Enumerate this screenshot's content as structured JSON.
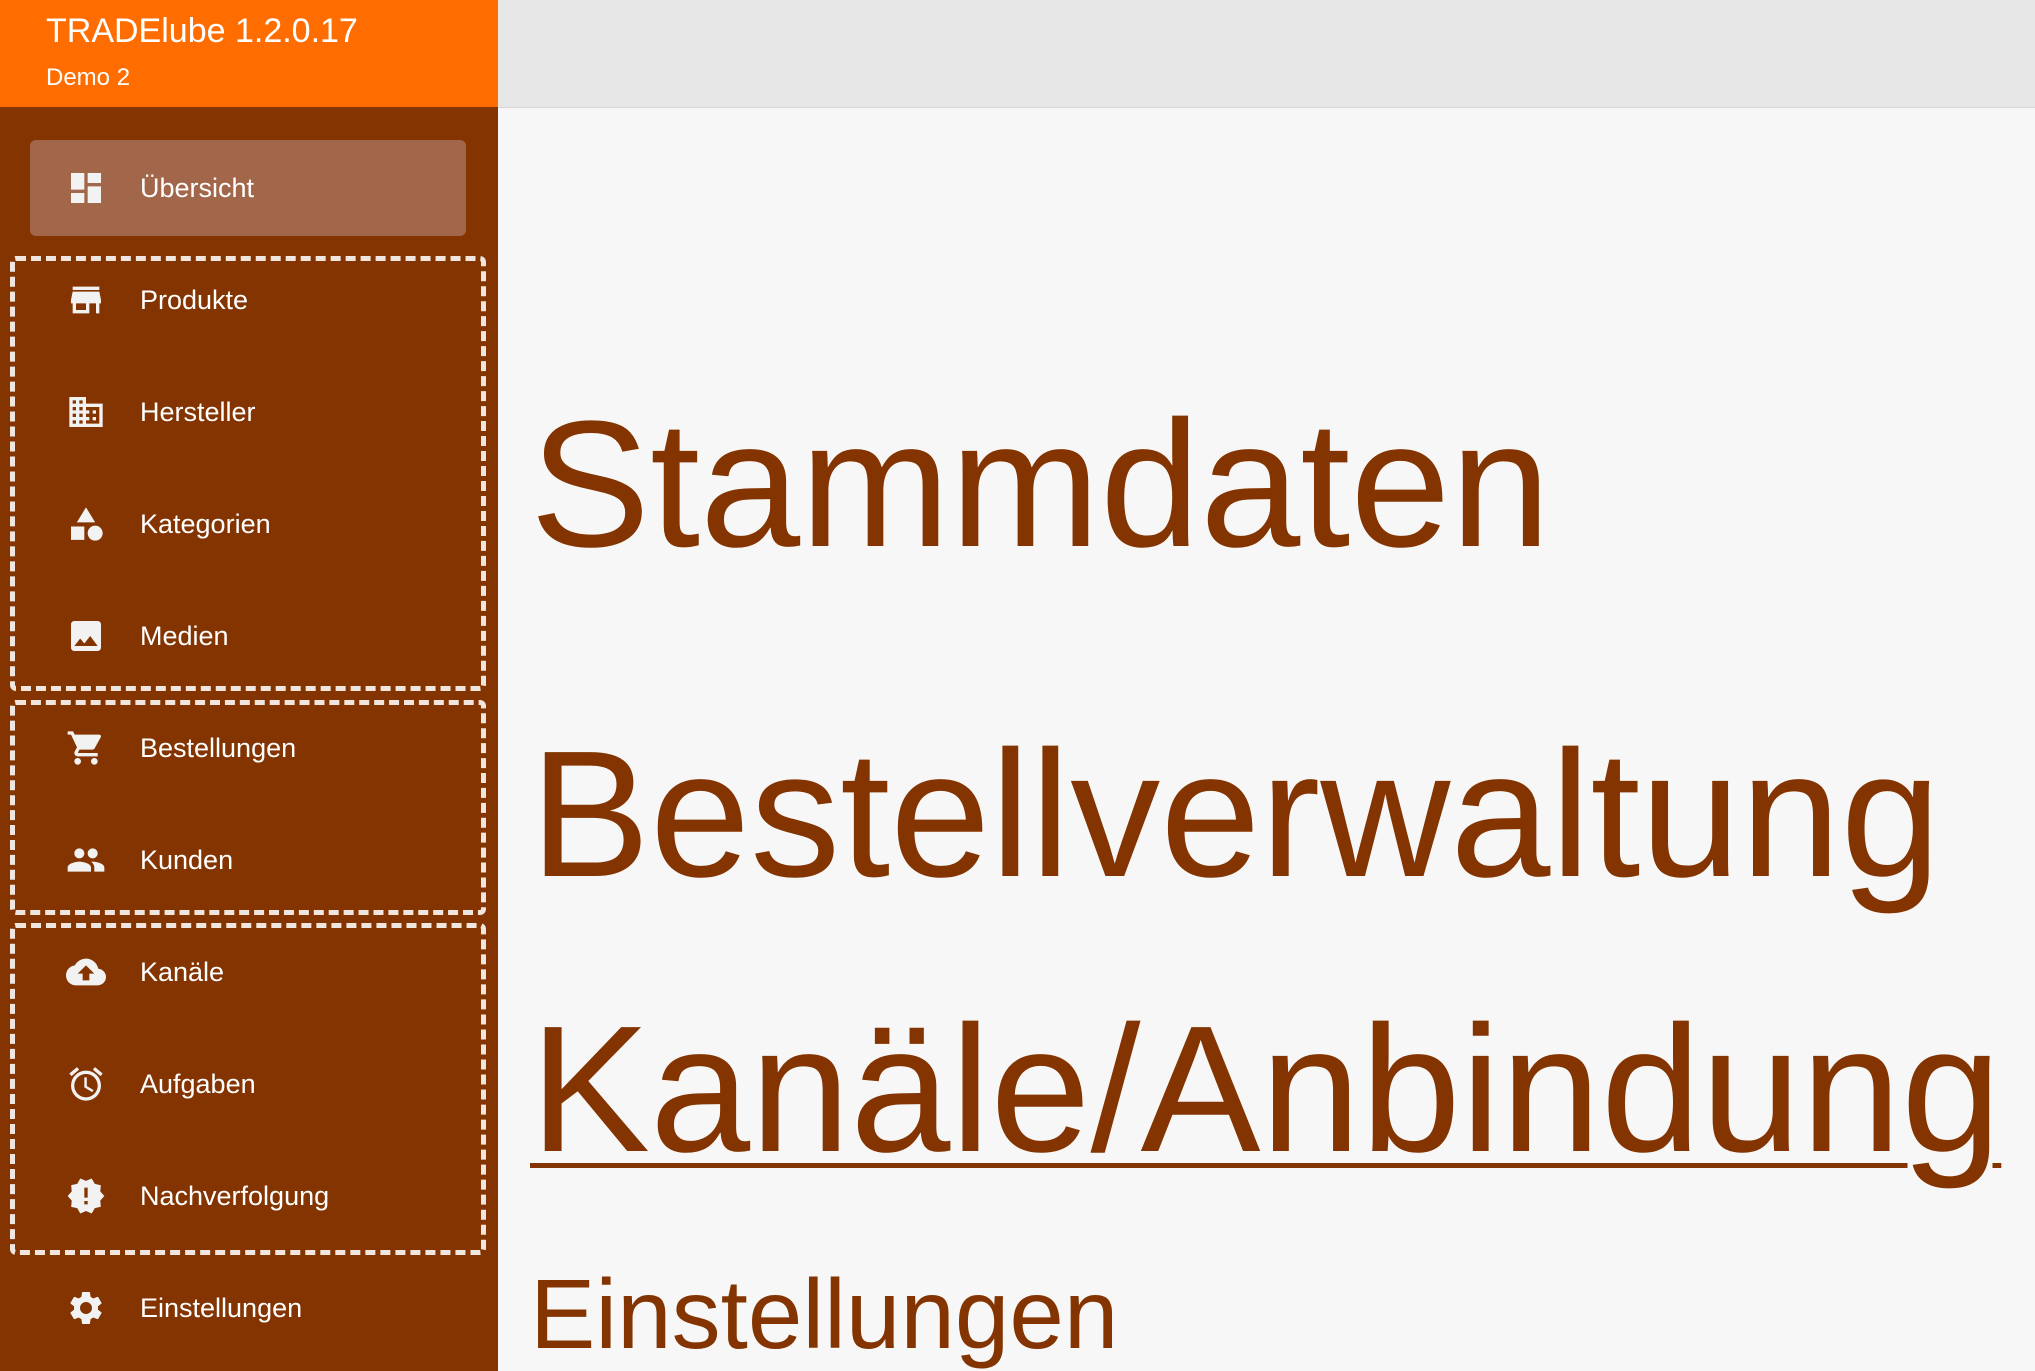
{
  "brand": {
    "title": "TRADElube 1.2.0.17",
    "subtitle": "Demo 2"
  },
  "sidebar": {
    "items": [
      {
        "label": "Übersicht",
        "icon": "dashboard-icon",
        "active": true
      },
      {
        "label": "Produkte",
        "icon": "store-icon"
      },
      {
        "label": "Hersteller",
        "icon": "building-icon"
      },
      {
        "label": "Kategorien",
        "icon": "category-shapes-icon"
      },
      {
        "label": "Medien",
        "icon": "image-icon"
      },
      {
        "label": "Bestellungen",
        "icon": "cart-icon"
      },
      {
        "label": "Kunden",
        "icon": "people-icon"
      },
      {
        "label": "Kanäle",
        "icon": "cloud-upload-icon"
      },
      {
        "label": "Aufgaben",
        "icon": "alarm-icon"
      },
      {
        "label": "Nachverfolgung",
        "icon": "warning-badge-icon"
      },
      {
        "label": "Einstellungen",
        "icon": "gear-icon"
      }
    ]
  },
  "main": {
    "sections": [
      {
        "label": "Stammdaten"
      },
      {
        "label": "Bestellverwaltung"
      },
      {
        "label": "Kanäle/Anbindung"
      },
      {
        "label": "Einstellungen"
      }
    ]
  },
  "colors": {
    "brand": "#ff6d00",
    "sidebar": "#833400",
    "active_item": "#a2674a",
    "heading": "#833400"
  }
}
